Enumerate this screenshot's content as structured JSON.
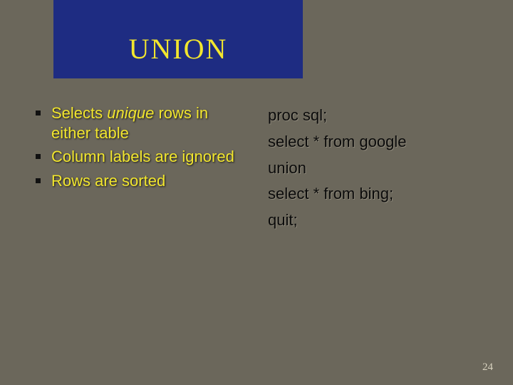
{
  "title": "UNION",
  "bullets": [
    {
      "pre": "Selects ",
      "em": "unique",
      "post": " rows in either table"
    },
    {
      "pre": "Column labels are ignored",
      "em": "",
      "post": ""
    },
    {
      "pre": "Rows are sorted",
      "em": "",
      "post": ""
    }
  ],
  "code": [
    "proc sql;",
    "select * from google",
    "union",
    "select * from bing;",
    "quit;"
  ],
  "page_number": "24"
}
